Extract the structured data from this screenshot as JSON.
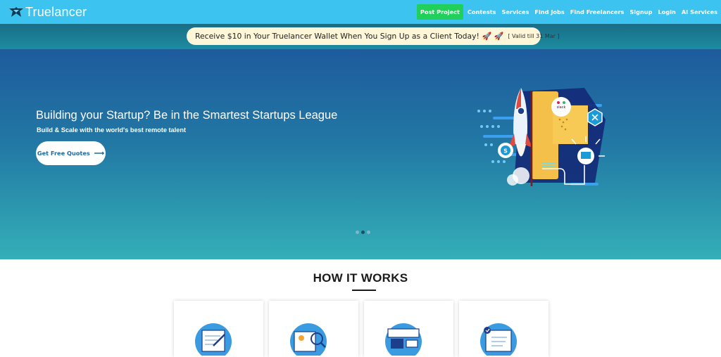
{
  "navbar": {
    "brand": "Truelancer",
    "links": {
      "post_project": "Post Project",
      "contests": "Contests",
      "services": "Services",
      "find_jobs": "Find Jobs",
      "find_freelancers": "Find Freelancers",
      "signup": "Signup",
      "login": "Login",
      "ai_services": "AI Services"
    }
  },
  "promo": {
    "text": "Receive $10 in Your Truelancer Wallet When You Sign Up as a Client Today!",
    "rockets": "🚀 🚀",
    "valid": "[ Valid till 31 Mar ]"
  },
  "hero": {
    "title": "Building your Startup? Be in the Smartest Startups League",
    "subtitle": "Build & Scale with the world's best remote talent",
    "cta_label": "Get Free Quotes",
    "cta_arrow": "⟶",
    "slide_count": 3,
    "active_slide": 2
  },
  "how_it_works": {
    "title": "HOW IT WORKS",
    "cards": 4
  },
  "colors": {
    "navbar": "#3cc3ef",
    "post_project": "#20d05a",
    "promo_strip": "#1c8ca0",
    "promo_pill": "#fdf6d8",
    "hero_top": "#1d5b9d",
    "hero_bottom": "#34afb8",
    "cta_text": "#1f6aa0"
  },
  "icons": [
    "truelancer-logo-icon",
    "rocket-icon",
    "slack-icon",
    "skype-icon",
    "lightbulb-icon",
    "card-step-icon"
  ]
}
